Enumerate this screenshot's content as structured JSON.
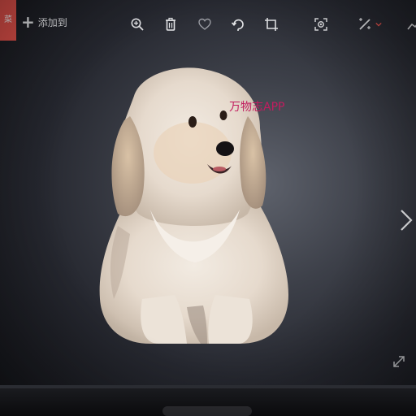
{
  "toolbar": {
    "accent_tab_label": "菜",
    "add_label": "添加到",
    "tools": [
      "zoom-in-icon",
      "delete-icon",
      "favorite-icon",
      "rotate-icon",
      "crop-icon",
      "fit-icon",
      "edit-icon"
    ]
  },
  "photo": {
    "subject": "dog"
  },
  "watermark": "万物志APP",
  "colors": {
    "accent": "#e8534c",
    "watermark": "#c21c5f",
    "background": "#2b2d34"
  }
}
